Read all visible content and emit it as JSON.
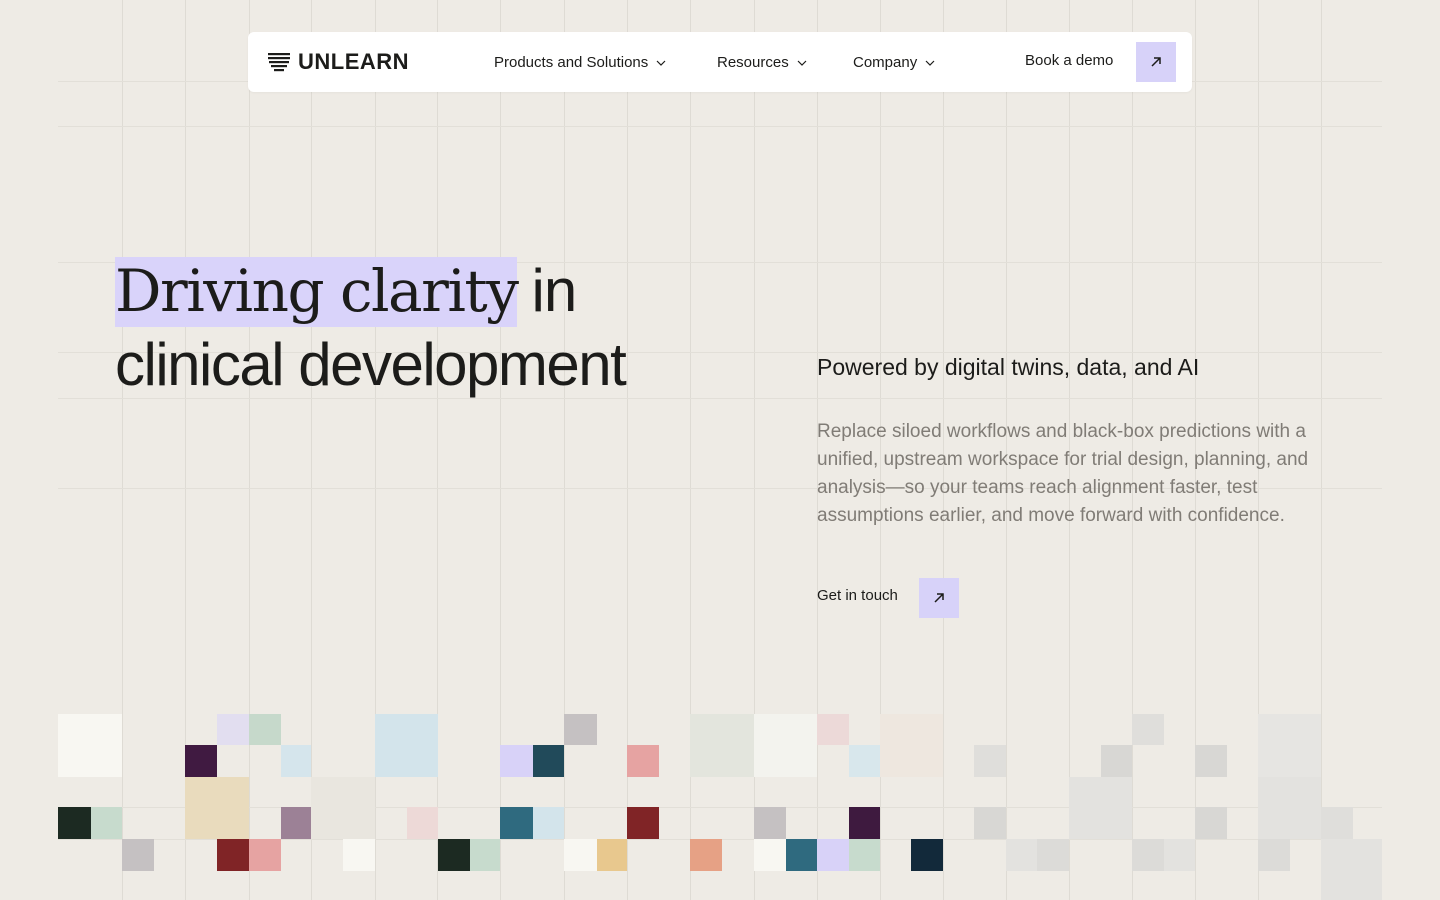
{
  "brand": {
    "name": "UNLEARN"
  },
  "nav": {
    "items": [
      {
        "label": "Products and Solutions"
      },
      {
        "label": "Resources"
      },
      {
        "label": "Company"
      }
    ],
    "cta_label": "Book a demo"
  },
  "hero": {
    "headline_highlight": "Driving clarity",
    "headline_rest": "in",
    "headline_line2": "clinical development",
    "subheading": "Powered by digital twins, data, and AI",
    "body": "Replace siloed workflows and black-box predictions with a unified, upstream workspace for trial design, planning, and analysis—so your teams reach alignment faster, test assumptions earlier, and move forward with confidence.",
    "cta_label": "Get in touch"
  },
  "icons": {
    "logo": "stacked-lines-logo-icon",
    "dropdown": "chevron-down-icon",
    "arrow": "arrow-up-right-icon"
  },
  "colors": {
    "background": "#eeebe5",
    "accent": "#d7d2f9",
    "text": "#1c1c1a",
    "muted_text": "#807c76"
  }
}
